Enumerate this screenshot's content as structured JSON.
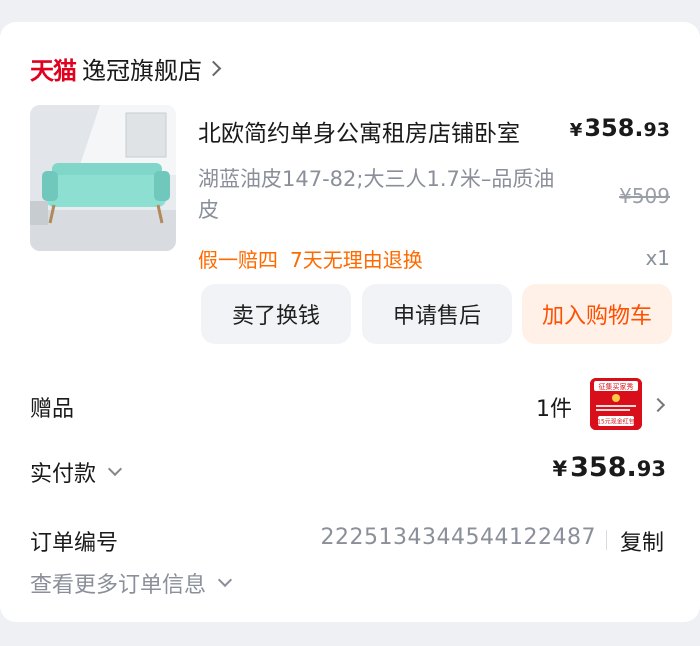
{
  "store": {
    "logo_text": "天猫",
    "name": "逸冠旗舰店"
  },
  "product": {
    "title": "北欧简约单身公寓租房店铺卧室",
    "price_currency": "¥",
    "price_int": "358.",
    "price_dec": "93",
    "sku": "湖蓝油皮147-82;大三人1.7米–品质油皮",
    "original_price": "¥509",
    "promises": [
      "假一赔四",
      "7天无理由退换"
    ],
    "quantity": "x1",
    "thumbnail_color": "#7fd6c9"
  },
  "actions": {
    "sell": "卖了换钱",
    "after_sale": "申请售后",
    "add_cart": "加入购物车"
  },
  "gift": {
    "label": "赠品",
    "count": "1件",
    "image_texts": [
      "征集买家秀",
      "15元现金红包"
    ]
  },
  "paid": {
    "label": "实付款",
    "currency": "¥",
    "amount_int": "358.",
    "amount_dec": "93"
  },
  "order": {
    "label": "订单编号",
    "number": "2225134344544122487",
    "copy": "复制",
    "more": "查看更多订单信息"
  },
  "colors": {
    "tmall_red": "#e1001e",
    "accent_orange": "#ff6a00",
    "cart_bg": "#fff0e8",
    "cart_text": "#ff5000"
  }
}
